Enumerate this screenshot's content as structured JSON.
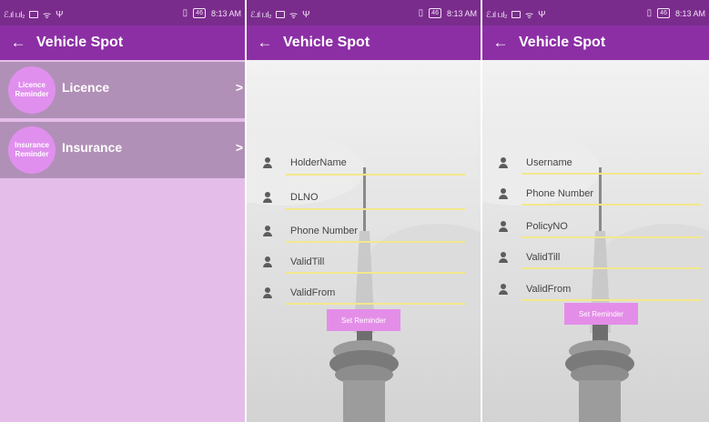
{
  "status_bar": {
    "signal_left": "ℰ.ıl ı.ıl₂",
    "battery": "46",
    "time": "8:13 AM"
  },
  "app_bar": {
    "back_icon": "←",
    "title": "Vehicle Spot"
  },
  "icons": [
    "back-arrow-icon",
    "person-icon",
    "chevron-right-icon",
    "signal-icon",
    "battery-icon",
    "usb-icon",
    "wifi-icon"
  ],
  "colors": {
    "status_bar": "#7a2c8c",
    "app_bar": "#8c2fa5",
    "list_item": "#b190b7",
    "list_bg": "#e4bde9",
    "badge": "#e08fee",
    "button": "#e48de8",
    "field_underline": "#f3e88a"
  },
  "reminder_list": {
    "items": [
      {
        "badge": [
          "Licence",
          "Reminder"
        ],
        "label": "Licence",
        "chevron": ">"
      },
      {
        "badge": [
          "Insurance",
          "Reminder"
        ],
        "label": "Insurance",
        "chevron": ">"
      }
    ]
  },
  "licence_form": {
    "fields": [
      {
        "placeholder": "HolderName"
      },
      {
        "placeholder": "DLNO"
      },
      {
        "placeholder": "Phone Number"
      },
      {
        "placeholder": "ValidTill"
      },
      {
        "placeholder": "ValidFrom"
      }
    ],
    "button": "Set Reminder"
  },
  "insurance_form": {
    "fields": [
      {
        "placeholder": "Username"
      },
      {
        "placeholder": "Phone Number"
      },
      {
        "placeholder": "PolicyNO"
      },
      {
        "placeholder": "ValidTill"
      },
      {
        "placeholder": "ValidFrom"
      }
    ],
    "button": "Set Reminder"
  }
}
